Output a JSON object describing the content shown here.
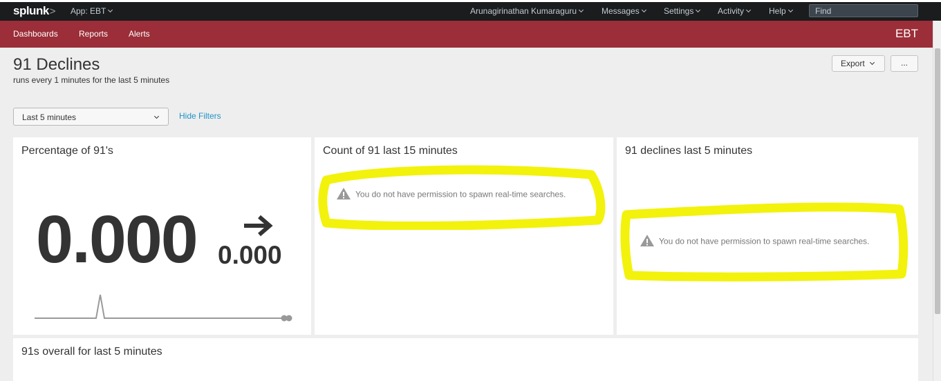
{
  "topbar": {
    "logo": "splunk",
    "logo_suffix": ">",
    "app_menu": "App: EBT",
    "user": "Arunagirinathan Kumaraguru",
    "messages": "Messages",
    "settings": "Settings",
    "activity": "Activity",
    "help": "Help",
    "find_placeholder": "Find"
  },
  "appbar": {
    "nav": [
      "Dashboards",
      "Reports",
      "Alerts"
    ],
    "app_title": "EBT"
  },
  "dashboard": {
    "title": "91 Declines",
    "description": "runs every 1 minutes for the last 5 minutes",
    "export_label": "Export",
    "more_label": "..."
  },
  "filters": {
    "time_range": "Last 5 minutes",
    "hide_filters": "Hide Filters"
  },
  "panels": [
    {
      "title": "Percentage of 91's",
      "value": "0.000",
      "delta": "0.000",
      "trend_icon": "arrow-right-icon"
    },
    {
      "title": "Count of 91 last 15 minutes",
      "message": "You do not have permission to spawn real-time searches."
    },
    {
      "title": "91 declines last 5 minutes",
      "message": "You do not have permission to spawn real-time searches."
    },
    {
      "title": "91s overall for last 5 minutes"
    }
  ],
  "colors": {
    "topbar_bg": "#1a1c1d",
    "appbar_bg": "#9b2e38",
    "link": "#1e93c6",
    "highlight": "#f2f20c"
  }
}
